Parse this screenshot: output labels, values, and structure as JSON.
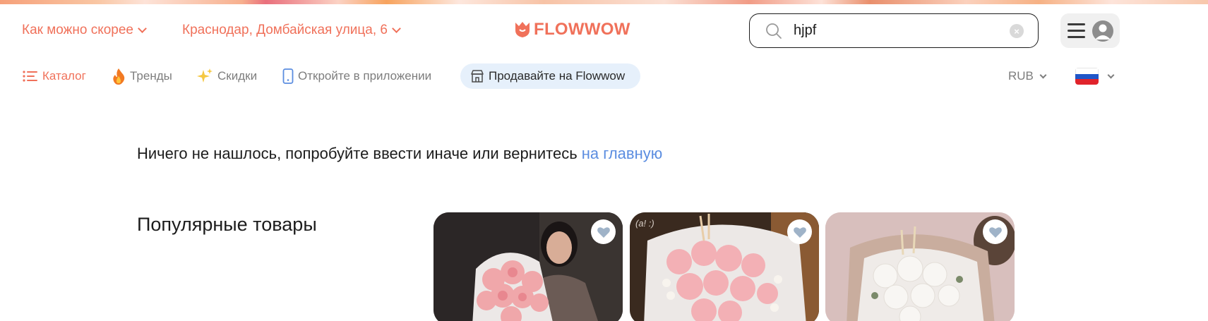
{
  "header": {
    "delivery_time": "Как можно скорее",
    "delivery_address": "Краснодар, Домбайская улица, 6",
    "logo_text": "FLOWWOW",
    "search": {
      "value": "hjpf"
    }
  },
  "nav": {
    "catalog": "Каталог",
    "trends": "Тренды",
    "discounts": "Скидки",
    "app": "Откройте в приложении",
    "sell": "Продавайте на Flowwow",
    "currency": "RUB"
  },
  "content": {
    "not_found_text": "Ничего не нашлось, попробуйте ввести иначе или вернитесь ",
    "not_found_link": "на главную",
    "popular_title": "Популярные товары",
    "products": [
      {
        "image": "pink chrysanthemum bouquet held by woman",
        "overlay_text": ""
      },
      {
        "image": "pink chrysanthemum bouquet with cotton",
        "overlay_text": "(a! :)"
      },
      {
        "image": "white chrysanthemum bouquet",
        "overlay_text": ""
      }
    ]
  },
  "colors": {
    "accent": "#f0715a",
    "link": "#5b8de0",
    "pill_bg": "#e6f0fb"
  },
  "icons": [
    "chevron-down-icon",
    "tulip-logo-icon",
    "search-icon",
    "clear-icon",
    "burger-menu-icon",
    "user-avatar-icon",
    "catalog-list-icon",
    "fire-icon",
    "sparkles-icon",
    "phone-icon",
    "shop-icon",
    "russia-flag-icon",
    "heart-icon"
  ]
}
